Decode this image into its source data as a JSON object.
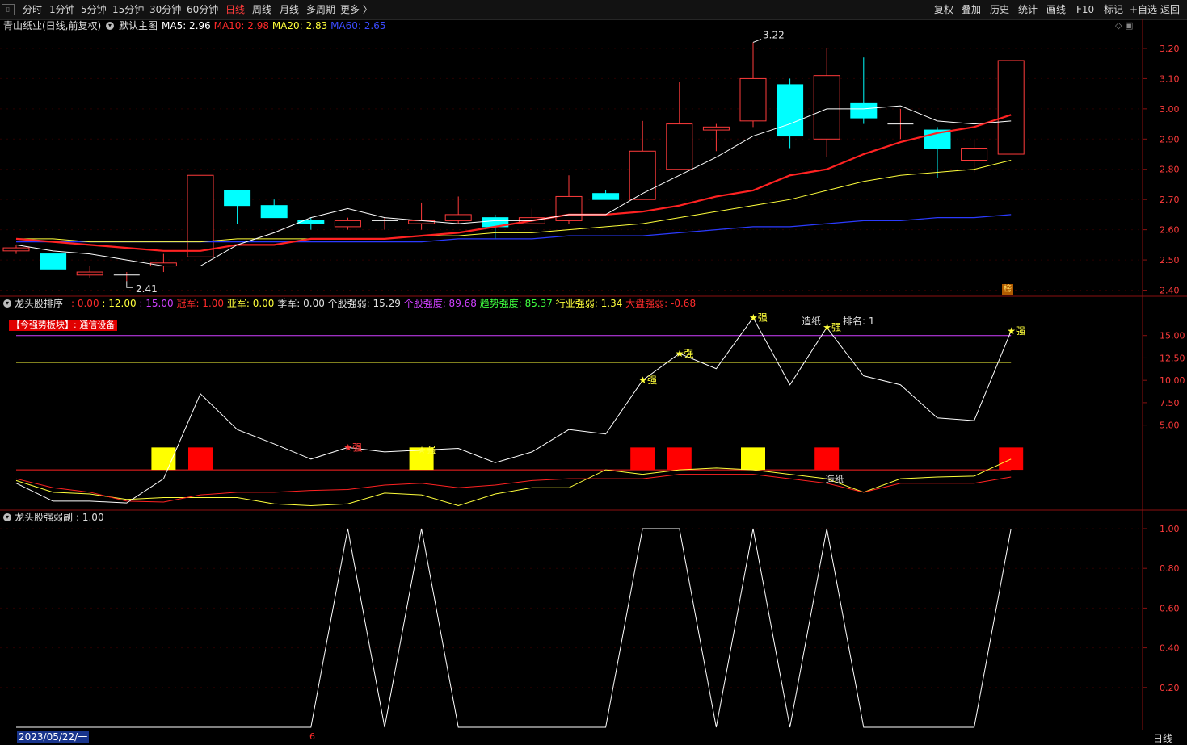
{
  "toolbar": {
    "left": [
      "分时",
      "1分钟",
      "5分钟",
      "15分钟",
      "30分钟",
      "60分钟",
      "日线",
      "周线",
      "月线",
      "多周期",
      "更多 〉"
    ],
    "active": "日线",
    "right": [
      "复权",
      "叠加",
      "历史",
      "统计",
      "画线",
      "F10",
      "标记",
      "+自选",
      "返回"
    ]
  },
  "main_panel": {
    "stock": "青山纸业(日线,前复权)",
    "template": "默认主图",
    "ma": [
      {
        "label": "MA5: 2.96",
        "color": "#ffffff"
      },
      {
        "label": "MA10: 2.98",
        "color": "#ff2b2b"
      },
      {
        "label": "MA20: 2.83",
        "color": "#ffff3b"
      },
      {
        "label": "MA60: 2.65",
        "color": "#3b4bff"
      }
    ],
    "high_label": "3.22",
    "low_label": "2.41",
    "y_ticks": [
      "3.20",
      "3.10",
      "3.00",
      "2.90",
      "2.80",
      "2.70",
      "2.60",
      "2.50",
      "2.40"
    ],
    "badge": "榜"
  },
  "ranking_panel": {
    "title": "龙头股排序",
    "stats": [
      {
        "text": ": 0.00",
        "color": "#ff2b2b"
      },
      {
        "text": ": 12.00",
        "color": "#ffff3b"
      },
      {
        "text": ": 15.00",
        "color": "#d040ff"
      },
      {
        "text": "冠军: 1.00",
        "color": "#ff2b2b"
      },
      {
        "text": "亚军: 0.00",
        "color": "#ffff3b"
      },
      {
        "text": "季军: 0.00",
        "color": "#e0e0e0"
      },
      {
        "text": "个股强弱: 15.29",
        "color": "#e0e0e0"
      },
      {
        "text": "个股强度: 89.68",
        "color": "#d040ff"
      },
      {
        "text": "趋势强度: 85.37",
        "color": "#40ff40"
      },
      {
        "text": "行业强弱: 1.34",
        "color": "#ffff3b"
      },
      {
        "text": "大盘强弱: -0.68",
        "color": "#ff2b2b"
      }
    ],
    "sector_label": "【今强势板块】: 通信设备",
    "rank_label": "造纸",
    "rank_text": "排名: 1",
    "bottom_label": "造纸",
    "y_ticks": [
      "15.00",
      "12.50",
      "10.00",
      "7.50",
      "5.00"
    ],
    "star_label": "★强"
  },
  "sub_panel": {
    "title": "龙头股强弱副",
    "value": ": 1.00",
    "y_ticks": [
      "1.00",
      "0.80",
      "0.60",
      "0.40",
      "0.20"
    ]
  },
  "bottom": {
    "date": "2023/05/22/一",
    "tick": "6",
    "period": "日线"
  },
  "chart_data": [
    {
      "type": "candlestick",
      "title": "青山纸业(日线,前复权)",
      "ylim": [
        2.38,
        3.24
      ],
      "ohlc": [
        [
          2.53,
          2.54,
          2.52,
          2.55
        ],
        [
          2.52,
          2.47,
          2.47,
          2.52
        ],
        [
          2.45,
          2.46,
          2.44,
          2.48
        ],
        [
          2.45,
          2.45,
          2.43,
          2.46
        ],
        [
          2.48,
          2.49,
          2.46,
          2.52
        ],
        [
          2.51,
          2.78,
          2.51,
          2.78
        ],
        [
          2.73,
          2.68,
          2.62,
          2.73
        ],
        [
          2.68,
          2.64,
          2.64,
          2.7
        ],
        [
          2.63,
          2.62,
          2.6,
          2.64
        ],
        [
          2.61,
          2.63,
          2.6,
          2.64
        ],
        [
          2.63,
          2.63,
          2.6,
          2.64
        ],
        [
          2.62,
          2.63,
          2.6,
          2.69
        ],
        [
          2.63,
          2.65,
          2.62,
          2.71
        ],
        [
          2.64,
          2.61,
          2.57,
          2.65
        ],
        [
          2.62,
          2.64,
          2.62,
          2.67
        ],
        [
          2.63,
          2.71,
          2.62,
          2.78
        ],
        [
          2.72,
          2.7,
          2.7,
          2.73
        ],
        [
          2.7,
          2.86,
          2.7,
          2.96
        ],
        [
          2.8,
          2.95,
          2.8,
          3.09
        ],
        [
          2.93,
          2.94,
          2.86,
          2.95
        ],
        [
          2.96,
          3.1,
          2.94,
          3.22
        ],
        [
          3.08,
          2.91,
          2.87,
          3.1
        ],
        [
          2.9,
          3.11,
          2.84,
          3.2
        ],
        [
          3.02,
          2.97,
          2.95,
          3.17
        ],
        [
          2.95,
          2.95,
          2.9,
          3.0
        ],
        [
          2.93,
          2.87,
          2.77,
          2.94
        ],
        [
          2.83,
          2.87,
          2.79,
          2.9
        ],
        [
          2.85,
          3.16,
          2.85,
          3.16
        ]
      ],
      "ma5": [
        2.55,
        2.53,
        2.52,
        2.5,
        2.48,
        2.48,
        2.55,
        2.59,
        2.64,
        2.67,
        2.64,
        2.63,
        2.62,
        2.63,
        2.63,
        2.65,
        2.65,
        2.72,
        2.78,
        2.84,
        2.91,
        2.95,
        3.0,
        3.0,
        3.01,
        2.96,
        2.95,
        2.96
      ],
      "ma10": [
        2.57,
        2.56,
        2.55,
        2.54,
        2.53,
        2.53,
        2.55,
        2.55,
        2.57,
        2.57,
        2.57,
        2.58,
        2.59,
        2.61,
        2.63,
        2.65,
        2.65,
        2.66,
        2.68,
        2.71,
        2.73,
        2.78,
        2.8,
        2.85,
        2.89,
        2.92,
        2.94,
        2.98
      ],
      "ma20": [
        2.57,
        2.57,
        2.56,
        2.56,
        2.56,
        2.56,
        2.57,
        2.57,
        2.57,
        2.57,
        2.57,
        2.58,
        2.58,
        2.59,
        2.59,
        2.6,
        2.61,
        2.62,
        2.64,
        2.66,
        2.68,
        2.7,
        2.73,
        2.76,
        2.78,
        2.79,
        2.8,
        2.83
      ],
      "ma60": [
        2.56,
        2.56,
        2.56,
        2.56,
        2.56,
        2.56,
        2.56,
        2.56,
        2.56,
        2.56,
        2.56,
        2.56,
        2.57,
        2.57,
        2.57,
        2.58,
        2.58,
        2.58,
        2.59,
        2.6,
        2.61,
        2.61,
        2.62,
        2.63,
        2.63,
        2.64,
        2.64,
        2.65
      ]
    },
    {
      "type": "line",
      "title": "龙头股排序",
      "ylim": [
        -4.5,
        17.5
      ],
      "ref_lines": [
        15.0,
        12.0,
        0.0
      ],
      "strength": [
        -1.5,
        -3.5,
        -3.5,
        -3.7,
        -1.0,
        8.5,
        4.5,
        2.9,
        1.2,
        2.5,
        2.0,
        2.2,
        2.4,
        0.8,
        2.0,
        4.5,
        4.0,
        10.0,
        13.0,
        11.3,
        17.0,
        9.5,
        15.9,
        10.5,
        9.5,
        5.8,
        5.5,
        15.5
      ],
      "line2": [
        -1.0,
        -2.0,
        -2.5,
        -3.5,
        -3.6,
        -2.8,
        -2.5,
        -2.5,
        -2.3,
        -2.2,
        -1.7,
        -1.5,
        -2.0,
        -1.7,
        -1.2,
        -1.0,
        -1.0,
        -1.0,
        -0.5,
        -0.5,
        -0.5,
        -1.0,
        -1.5,
        -2.5,
        -1.5,
        -1.5,
        -1.5,
        -0.8
      ],
      "line3": [
        -1.2,
        -2.5,
        -2.7,
        -3.3,
        -3.1,
        -3.1,
        -3.1,
        -3.8,
        -4.0,
        -3.8,
        -2.6,
        -2.8,
        -4.0,
        -2.7,
        -2.0,
        -2.0,
        0.0,
        -0.5,
        0.0,
        0.2,
        0.0,
        -0.5,
        -1.0,
        -2.5,
        -1.0,
        -0.8,
        -0.7,
        1.2
      ],
      "rect_bars": {
        "yellow": [
          4,
          11,
          20
        ],
        "red": [
          5,
          17,
          18,
          22,
          27
        ]
      },
      "star_markers": [
        9,
        11,
        17,
        18,
        20,
        22,
        27
      ]
    },
    {
      "type": "line",
      "title": "龙头股强弱副",
      "ylim": [
        -0.1,
        1.07
      ],
      "values": [
        0,
        0,
        0,
        0,
        0,
        0,
        0,
        0,
        0,
        1,
        0,
        1,
        0,
        0,
        0,
        0,
        0,
        1,
        1,
        0,
        1,
        0,
        1,
        0,
        0,
        0,
        0,
        1
      ]
    }
  ]
}
